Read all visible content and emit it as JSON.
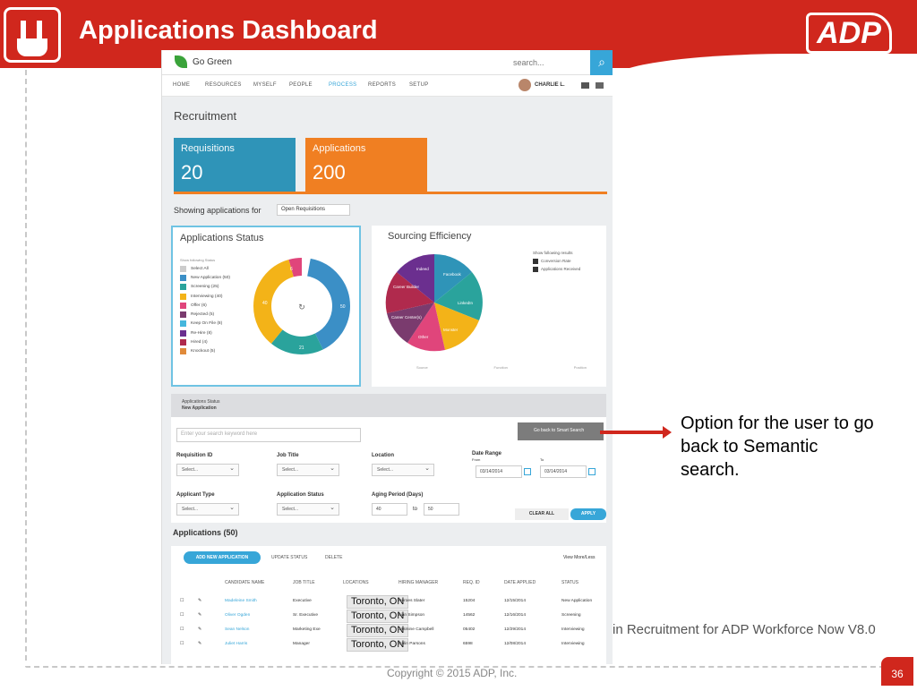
{
  "slide": {
    "title": "Applications Dashboard",
    "logo": "ADP",
    "callout": "Option for the user to go back to Semantic search.",
    "footer": "in Recruitment for ADP Workforce Now V8.0",
    "copyright": "Copyright © 2015 ADP, Inc.",
    "page_number": "36",
    "accent": "#d0271d"
  },
  "app": {
    "brand": "Go Green",
    "search_placeholder": "search...",
    "nav": [
      "HOME",
      "RESOURCES",
      "MYSELF",
      "PEOPLE",
      "PROCESS",
      "REPORTS",
      "SETUP"
    ],
    "nav_active": "PROCESS",
    "user": "CHARLIE L.",
    "page_title": "Recruitment",
    "tiles": [
      {
        "label": "Requisitions",
        "value": "20"
      },
      {
        "label": "Applications",
        "value": "200"
      }
    ],
    "showing_label": "Showing applications for",
    "showing_value": "Open Requisitions",
    "status_card": {
      "title": "Applications Status",
      "legend_head": "Show following Status",
      "legend": [
        {
          "label": "Select All",
          "color": "#cccccc"
        },
        {
          "label": "New Application (50)",
          "color": "#3b8fc6"
        },
        {
          "label": "Screening (25)",
          "color": "#2aa39c"
        },
        {
          "label": "Interviewing (40)",
          "color": "#f3b318"
        },
        {
          "label": "Offer (6)",
          "color": "#e0457b"
        },
        {
          "label": "Rejected (5)",
          "color": "#7a3b6e"
        },
        {
          "label": "Keep On File (8)",
          "color": "#45b7dd"
        },
        {
          "label": "Re-Hire (8)",
          "color": "#6b2f8f"
        },
        {
          "label": "Hired (4)",
          "color": "#b02a4d"
        },
        {
          "label": "Knockout (5)",
          "color": "#e08a3a"
        }
      ],
      "donut_labels": [
        "50",
        "21",
        "40",
        "6"
      ]
    },
    "source_card": {
      "title": "Sourcing Efficiency",
      "options_head": "Show following results",
      "options": [
        "Conversion Rate",
        "Applications Received"
      ],
      "slices": [
        "Indeed",
        "Facebook",
        "LinkedIn",
        "Monster",
        "Other",
        "Career Center(s)",
        "Career Builder"
      ],
      "axis": [
        "Source",
        "Function",
        "Position"
      ]
    },
    "filter": {
      "head_label": "Applications Status",
      "head_value": "New Application",
      "keyword_placeholder": "Enter your search keyword here",
      "back_button": "Go back to Smart Search",
      "labels": {
        "req_id": "Requisition ID",
        "job_title": "Job Title",
        "location": "Location",
        "date_range": "Date Range",
        "from": "From",
        "to": "To",
        "applicant_type": "Applicant Type",
        "app_status": "Application Status",
        "aging": "Aging Period (Days)",
        "aging_to": "to"
      },
      "select_placeholder": "Select...",
      "date_from": "03/14/2014",
      "date_to": "03/14/2014",
      "aging_from": "40",
      "aging_to_val": "50",
      "clear": "CLEAR ALL",
      "apply": "APPLY"
    },
    "apps": {
      "title": "Applications (50)",
      "add": "ADD NEW APPLICATION",
      "update": "UPDATE STATUS",
      "delete": "DELETE",
      "view_more": "View More/Less",
      "headers": [
        "CANDIDATE NAME",
        "JOB TITLE",
        "LOCATIONS",
        "HIRING MANAGER",
        "REQ. ID",
        "DATE APPLIED",
        "STATUS"
      ],
      "rows": [
        {
          "name": "Madeleine Smith",
          "job": "Executive",
          "loc": "Toronto, ON",
          "mgr": "Heroes Slater",
          "req": "15204",
          "date": "12/15/2014",
          "status": "New Application"
        },
        {
          "name": "Oliver Ogden",
          "job": "Sr. Executive",
          "loc": "Toronto, ON",
          "mgr": "Lian Simpson",
          "req": "14562",
          "date": "12/16/2014",
          "status": "Screening"
        },
        {
          "name": "Sean Nelson",
          "job": "Marketing Exe",
          "loc": "Toronto, ON",
          "mgr": "Jasmine Campbell",
          "req": "05402",
          "date": "12/29/2014",
          "status": "Interviewing"
        },
        {
          "name": "Juliet Harris",
          "job": "Manager",
          "loc": "Toronto, ON",
          "mgr": "Colin Parsons",
          "req": "6598",
          "date": "12/08/2014",
          "status": "Interviewing"
        }
      ]
    }
  }
}
